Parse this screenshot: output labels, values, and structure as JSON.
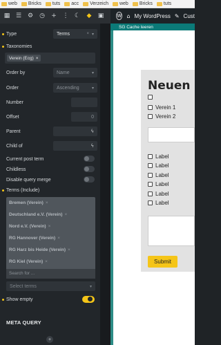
{
  "bookmarks": [
    "web",
    "Bricks",
    "tuts",
    "acc",
    "Verzeich",
    "web",
    "Bricks",
    "tuts"
  ],
  "adminbar": {
    "site": "My WordPress",
    "custom": "Cust"
  },
  "cache": {
    "label": "SG Cache leeren"
  },
  "panel": {
    "type": {
      "label": "Type",
      "value": "Terms"
    },
    "taxonomies": {
      "label": "Taxonomies",
      "chip": "Verein (Ecg)"
    },
    "order_by": {
      "label": "Order by",
      "value": "Name"
    },
    "order": {
      "label": "Order",
      "value": "Ascending"
    },
    "number": {
      "label": "Number"
    },
    "offset": {
      "label": "Offset",
      "placeholder": "0"
    },
    "parent": {
      "label": "Parent"
    },
    "child_of": {
      "label": "Child of"
    },
    "current_post_term": {
      "label": "Current post term",
      "on": false
    },
    "childless": {
      "label": "Childless",
      "on": false
    },
    "disable_query_merge": {
      "label": "Disable query merge",
      "on": false
    },
    "terms_include": {
      "label": "Terms (Include)",
      "items": [
        "Bremen (Verein)",
        "Deutschland e.V. (Verein)",
        "Nord e.V. (Verein)",
        "RG Hannover (Verein)",
        "RG Harz bis Heide (Verein)",
        "RG Kiel (Verein)"
      ],
      "search_placeholder": "Search for ..."
    },
    "terms_exclude": {
      "placeholder": "Select terms"
    },
    "show_empty": {
      "label": "Show empty",
      "on": true
    },
    "meta_query": {
      "label": "META QUERY"
    }
  },
  "preview": {
    "heading": "Neuen B",
    "checkboxes_top": [
      "",
      "Verein 1",
      "Verein 2"
    ],
    "checkboxes_bottom": [
      "Label",
      "Label",
      "Label",
      "Label",
      "Label",
      "Label"
    ],
    "submit": "Submit"
  },
  "colors": {
    "accent": "#f5c518",
    "panel": "#22262a",
    "cache_bar": "#0b7a78"
  }
}
